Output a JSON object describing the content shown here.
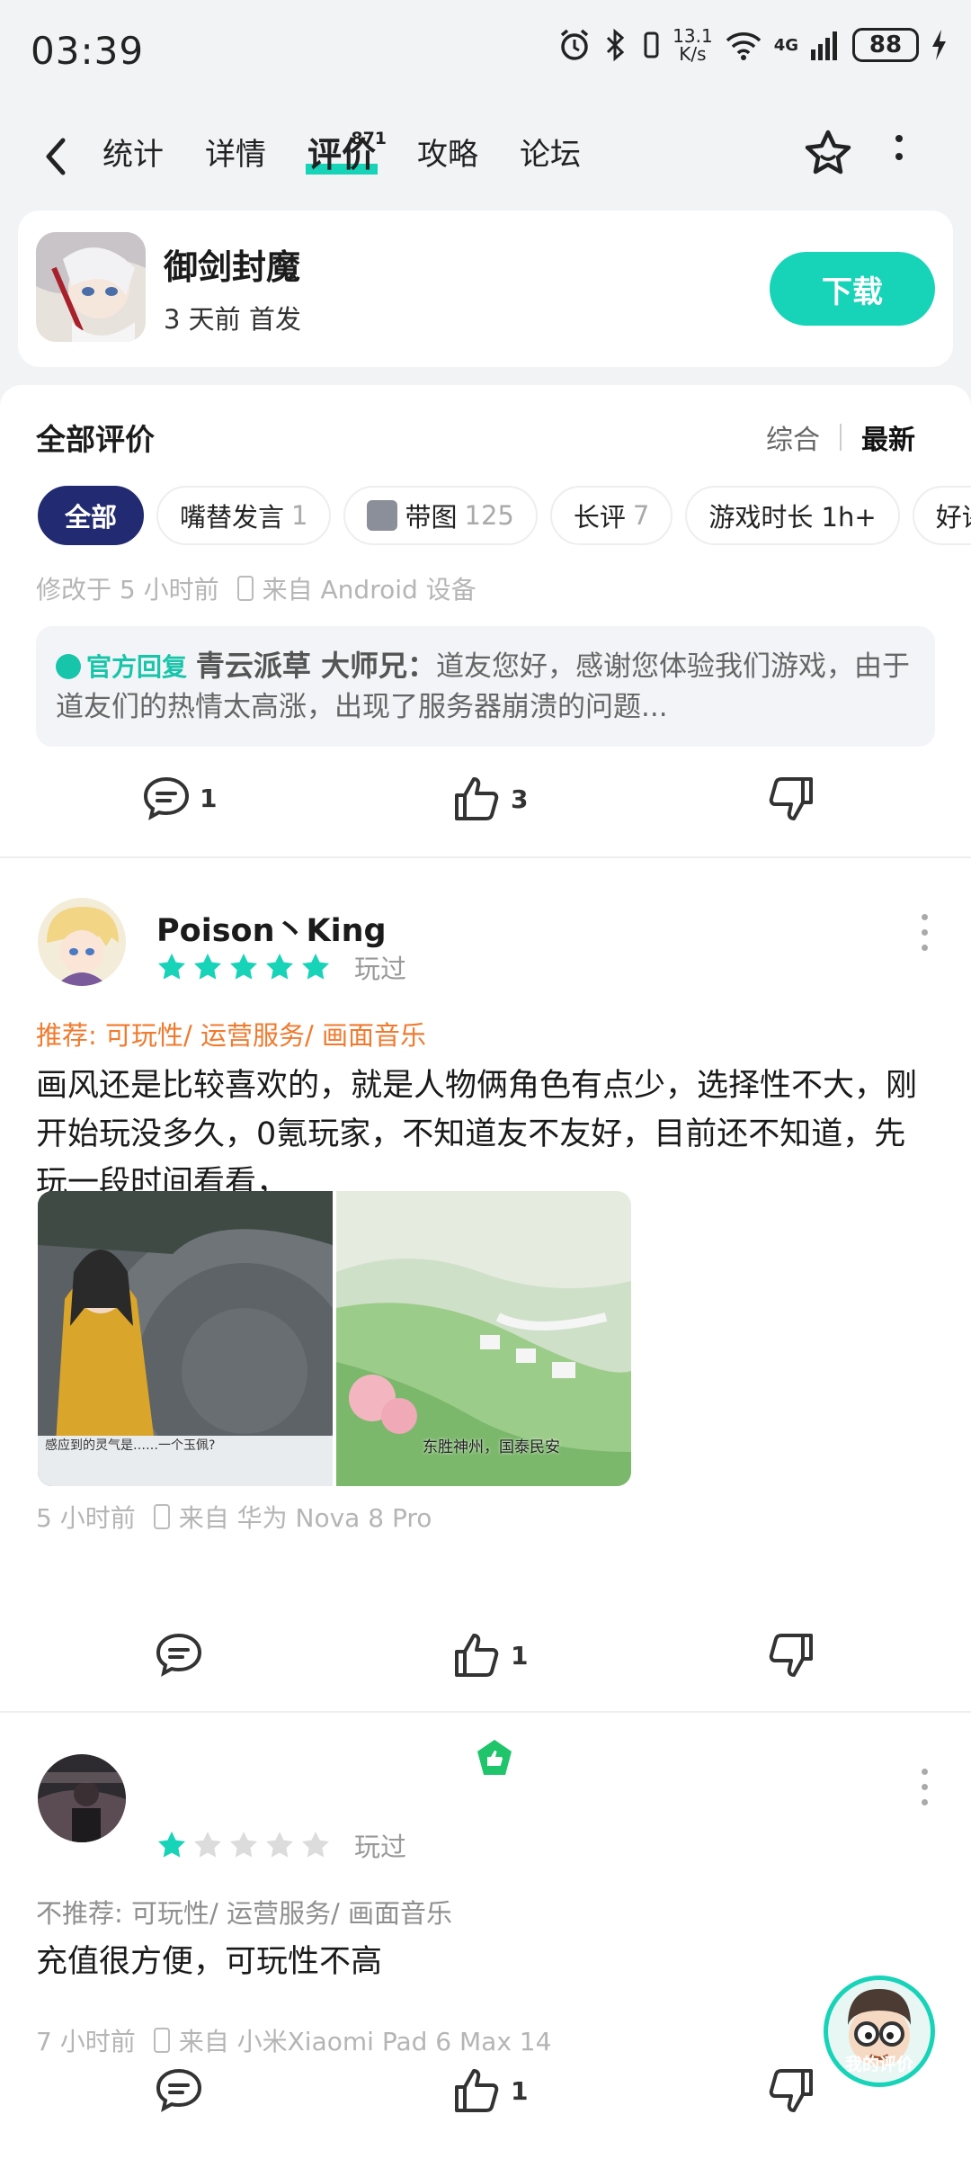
{
  "status": {
    "time": "03:39",
    "speed_top": "13.1",
    "speed_bottom": "K/s",
    "wifi_badge": "6",
    "net": "4G",
    "battery": "88"
  },
  "nav": {
    "tabs": [
      {
        "label": "统计"
      },
      {
        "label": "详情"
      },
      {
        "label": "评价",
        "count": "871"
      },
      {
        "label": "攻略"
      },
      {
        "label": "论坛"
      }
    ],
    "accent": "#17d3b8"
  },
  "game": {
    "name": "御剑封魔",
    "subtitle": "3 天前 首发",
    "download": "下载"
  },
  "reviews_header": {
    "title": "全部评价",
    "sort_comprehensive": "综合",
    "sort_latest": "最新"
  },
  "filters": [
    {
      "label": "全部"
    },
    {
      "label": "嘴替发言",
      "count": "1"
    },
    {
      "label": "带图",
      "count": "125"
    },
    {
      "label": "长评",
      "count": "7"
    },
    {
      "label": "游戏时长 1h+"
    },
    {
      "label": "好评"
    }
  ],
  "review0": {
    "modified": "修改于 5 小时前",
    "device": "来自 Android 设备",
    "reply_badge": "官方回复",
    "reply_author": "青云派草 大师兄：",
    "reply_text": "道友您好，感谢您体验我们游戏，由于道友们的热情太高涨，出现了服务器崩溃的问题...",
    "comments": "1",
    "likes": "3"
  },
  "review1": {
    "user": "Poison丶King",
    "rating": 5,
    "played": "玩过",
    "recommend": "推荐: 可玩性/ 运营服务/ 画面音乐",
    "text": "画风还是比较喜欢的，就是人物俩角色有点少，选择性不大，刚开始玩没多久，0氪玩家，不知道友不友好，目前还不知道，先玩一段时间看看，",
    "image1_caption": "感应到的灵气是……一个玉佩?",
    "image2_caption": "东胜神州，国泰民安",
    "time": "5 小时前",
    "device": "来自 华为 Nova 8 Pro",
    "likes": "1"
  },
  "review2": {
    "rating": 1,
    "played": "玩过",
    "recommend": "不推荐: 可玩性/ 运营服务/ 画面音乐",
    "text": "充值很方便，可玩性不高",
    "time": "7 小时前",
    "device": "来自 小米Xiaomi Pad 6 Max 14",
    "likes": "1"
  },
  "fab": {
    "label": "我的评价"
  }
}
